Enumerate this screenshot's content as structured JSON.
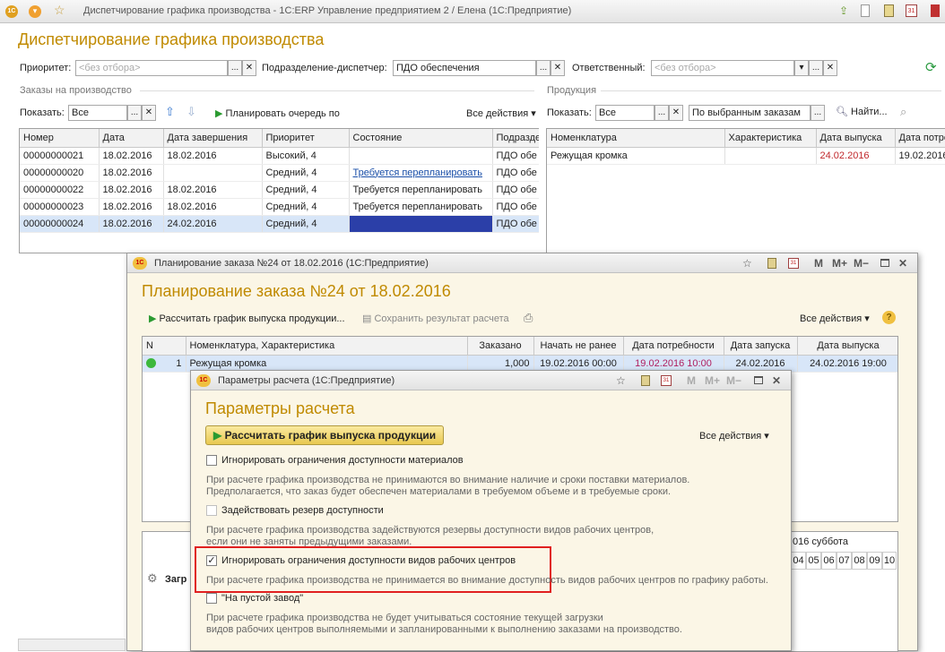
{
  "app": {
    "title": "Диспетчирование графика производства - 1С:ERP Управление предприятием 2 / Елена  (1С:Предприятие)",
    "page_title": "Диспетчирование графика производства"
  },
  "filters": {
    "priority_label": "Приоритет:",
    "priority_placeholder": "<без отбора>",
    "division_label": "Подразделение-диспетчер:",
    "division_value": "ПДО обеспечения",
    "responsible_label": "Ответственный:",
    "responsible_placeholder": "<без отбора>"
  },
  "orders": {
    "section_label": "Заказы на производство",
    "show_label": "Показать:",
    "show_value": "Все",
    "plan_button": "Планировать очередь по",
    "all_actions": "Все действия",
    "columns": [
      "Номер",
      "Дата",
      "Дата завершения",
      "Приоритет",
      "Состояние",
      "Подразде"
    ],
    "rows": [
      [
        "00000000021",
        "18.02.2016",
        "18.02.2016",
        "Высокий, 4",
        "",
        "ПДО обе"
      ],
      [
        "00000000020",
        "18.02.2016",
        "",
        "Средний, 4",
        "Требуется перепланировать",
        "ПДО обе"
      ],
      [
        "00000000022",
        "18.02.2016",
        "18.02.2016",
        "Средний, 4",
        "Требуется перепланировать",
        "ПДО обе"
      ],
      [
        "00000000023",
        "18.02.2016",
        "18.02.2016",
        "Средний, 4",
        "Требуется перепланировать",
        "ПДО обе"
      ],
      [
        "00000000024",
        "18.02.2016",
        "24.02.2016",
        "Средний, 4",
        "",
        "ПДО обе"
      ]
    ]
  },
  "products": {
    "section_label": "Продукция",
    "show_label": "Показать:",
    "show_value": "Все",
    "scope_value": "По выбранным заказам",
    "find_label": "Найти...",
    "columns": [
      "Номенклатура",
      "Характеристика",
      "Дата выпуска",
      "Дата потре"
    ],
    "rows": [
      [
        "Режущая кромка",
        "",
        "24.02.2016",
        "19.02.2016"
      ]
    ]
  },
  "planning": {
    "window_title": "Планирование заказа №24 от 18.02.2016  (1С:Предприятие)",
    "header": "Планирование заказа №24 от 18.02.2016",
    "calc_button": "Рассчитать график выпуска продукции...",
    "save_button": "Сохранить результат расчета",
    "all_actions": "Все действия",
    "columns": [
      "N",
      "Номенклатура, Характеристика",
      "Заказано",
      "Начать не ранее",
      "Дата потребности",
      "Дата запуска",
      "Дата выпуска"
    ],
    "row": {
      "n": "1",
      "name": "Режущая кромка",
      "ordered": "1,000",
      "start": "19.02.2016 00:00",
      "need": "19.02.2016 10:00",
      "launch": "24.02.2016",
      "release": "24.02.2016 19:00"
    },
    "bottom_label": "Загр",
    "day_label": "016 суббота",
    "hours": [
      "04",
      "05",
      "06",
      "07",
      "08",
      "09",
      "10"
    ]
  },
  "params": {
    "window_title": "Параметры расчета  (1С:Предприятие)",
    "header": "Параметры расчета",
    "run_button": "Рассчитать график выпуска продукции",
    "all_actions": "Все действия",
    "options": [
      {
        "label": "Игнорировать ограничения доступности материалов",
        "checked": false,
        "desc1": "При расчете графика производства не принимаются во внимание наличие и сроки поставки материалов.",
        "desc2": "Предполагается, что заказ будет обеспечен материалами в требуемом объеме и в требуемые сроки."
      },
      {
        "label": "Задействовать резерв доступности",
        "checked": false,
        "desc1": "При расчете графика производства задействуются резервы доступности видов рабочих центров,",
        "desc2": "если они не заняты предыдущими заказами."
      },
      {
        "label": "Игнорировать ограничения доступности видов рабочих центров",
        "checked": true,
        "desc1": "При расчете графика производства не принимается во внимание доступность видов рабочих центров по графику работы.",
        "desc2": ""
      },
      {
        "label": "\"На пустой завод\"",
        "checked": false,
        "desc1": "При расчете графика производства не будет учитываться состояние текущей загрузки",
        "desc2": "видов рабочих центров выполняемыми и запланированными к выполнению заказами на производство."
      }
    ]
  }
}
